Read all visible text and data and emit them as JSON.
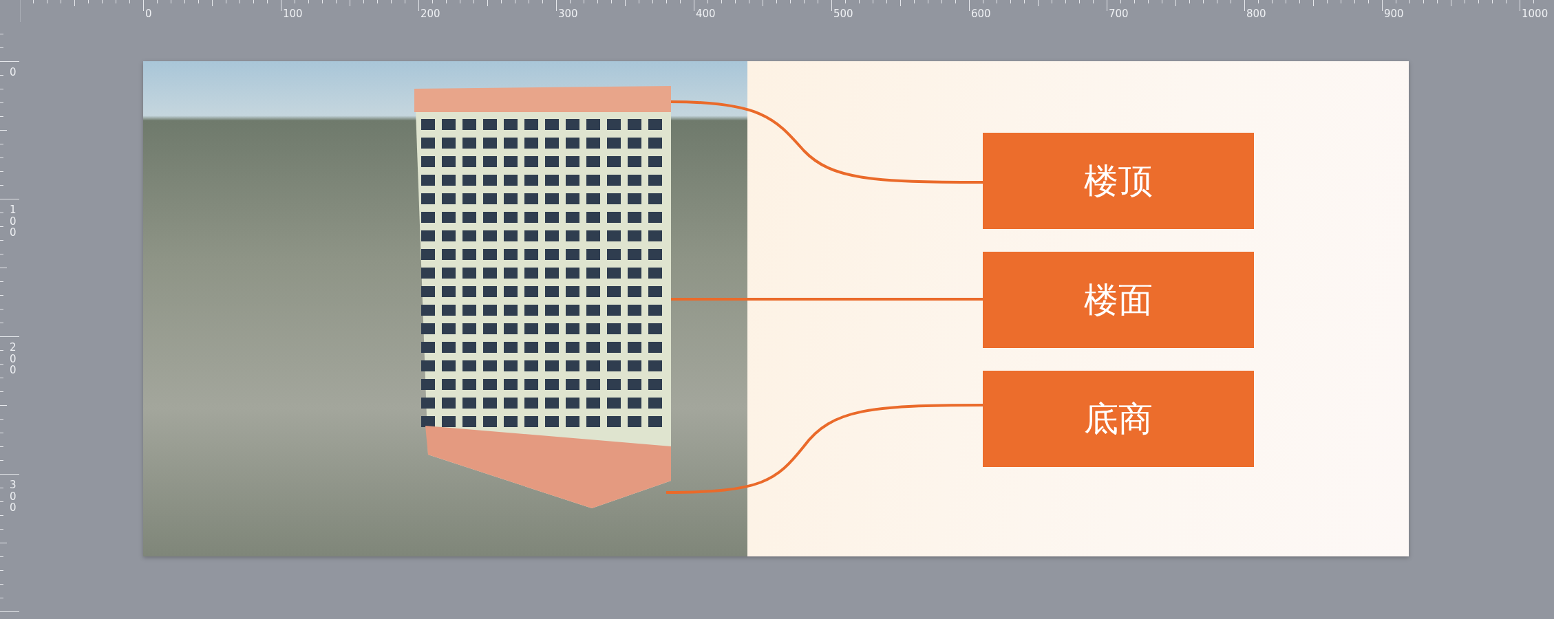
{
  "top_ruler": {
    "labels": [
      "0",
      "100",
      "200",
      "300",
      "400",
      "500",
      "600",
      "700",
      "800",
      "900",
      "1000"
    ]
  },
  "left_ruler": {
    "labels": [
      "0",
      "100",
      "200",
      "300"
    ]
  },
  "canvas": {
    "labels": [
      {
        "text": "楼顶"
      },
      {
        "text": "楼面"
      },
      {
        "text": "底商"
      }
    ]
  }
}
